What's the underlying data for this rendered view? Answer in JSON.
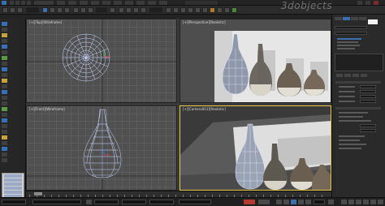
{
  "watermark": {
    "text": "3dobjects"
  },
  "viewports": {
    "top_left": {
      "label": "[+][Top][Wireframe]"
    },
    "top_right": {
      "label": "[+][Perspective][Realistic]"
    },
    "bottom_left": {
      "label": "[+][Front][Wireframe]"
    },
    "bottom_right": {
      "label": "[+][Camera001][Realistic]"
    }
  },
  "colors": {
    "ui_background": "#2a2a2a",
    "viewport_grey": "#505050",
    "active_viewport_border": "#e8c84a",
    "wireframe": "#c9d6ff",
    "selection_blue": "#3a6fb0"
  },
  "icons": {
    "menu_icons": [
      "app-icon",
      "undo-icon",
      "redo-icon",
      "open-icon",
      "save-icon"
    ],
    "main_toolbar_icons": [
      "select-icon",
      "select-by-name-icon",
      "move-icon",
      "rotate-icon",
      "scale-icon",
      "snap-icon",
      "mirror-icon",
      "align-icon",
      "material-editor-icon",
      "render-setup-icon",
      "render-icon"
    ],
    "command_panel_tabs": [
      "create-icon",
      "modify-icon",
      "hierarchy-icon",
      "motion-icon",
      "display-icon",
      "utilities-icon"
    ]
  }
}
